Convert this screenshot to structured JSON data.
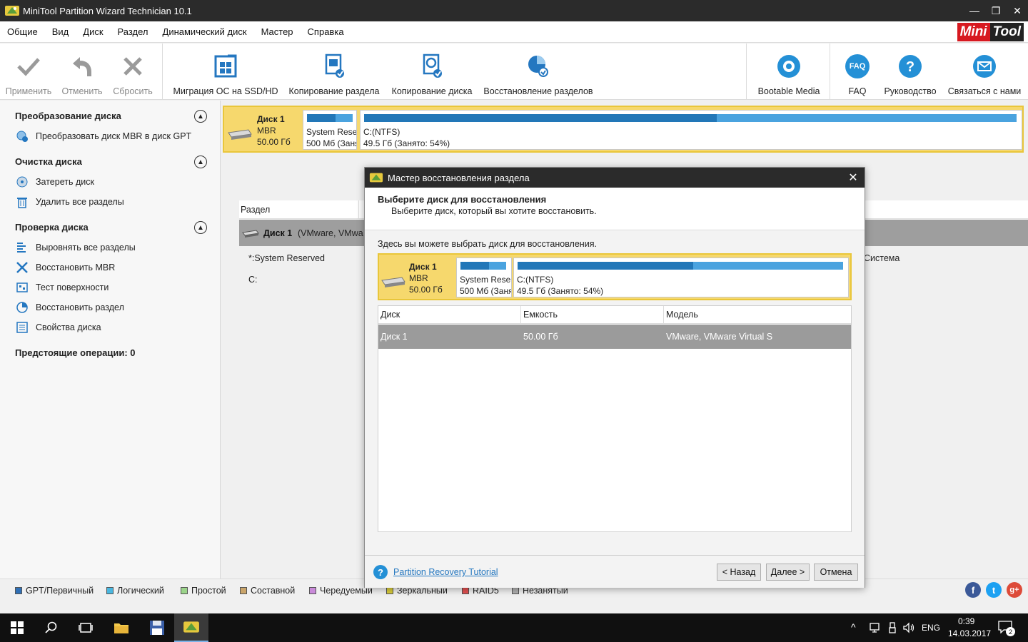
{
  "window": {
    "title": "MiniTool Partition Wizard Technician 10.1",
    "controls": {
      "minimize": "—",
      "maximize": "❐",
      "close": "✕"
    }
  },
  "menu": [
    "Общие",
    "Вид",
    "Диск",
    "Раздел",
    "Динамический диск",
    "Мастер",
    "Справка"
  ],
  "brand": {
    "part1": "Mini",
    "part2": "Tool",
    "colors": {
      "red": "#d71920",
      "dark": "#222222"
    }
  },
  "toolbar": {
    "apply": "Применить",
    "undo": "Отменить",
    "discard": "Сбросить",
    "migrate": "Миграция ОС на SSD/HD",
    "copy_partition": "Копирование раздела",
    "copy_disk": "Копирование диска",
    "recover_partitions": "Восстановление разделов",
    "bootable": "Bootable Media",
    "faq": "FAQ",
    "faq_icon_text": "FAQ",
    "manual": "Руководство",
    "contact": "Связаться с нами"
  },
  "sidebar": {
    "sections": [
      {
        "title": "Преобразование диска",
        "items": [
          "Преобразовать диск MBR в диск GPT"
        ]
      },
      {
        "title": "Очистка диска",
        "items": [
          "Затереть диск",
          "Удалить все разделы"
        ]
      },
      {
        "title": "Проверка диска",
        "items": [
          "Выровнять все разделы",
          "Восстановить MBR",
          "Тест поверхности",
          "Восстановить раздел",
          "Свойства диска"
        ]
      }
    ],
    "pending": "Предстоящие операции: 0"
  },
  "disk_map": {
    "name": "Диск 1",
    "type": "MBR",
    "size": "50.00 Гб",
    "partitions": [
      {
        "label": "System Rese",
        "detail": "500 Мб (Заня",
        "used_fraction": 0.62
      },
      {
        "label": "C:(NTFS)",
        "detail": "49.5 Гб (Занято: 54%)",
        "used_fraction": 0.54
      }
    ]
  },
  "grid": {
    "col_partition": "Раздел",
    "disk_row": "Диск 1",
    "disk_row_detail": "(VMware, VMwa",
    "rows": [
      "*:System Reserved",
      "C:"
    ],
    "right_col_value": "Система"
  },
  "legend": [
    {
      "label": "GPT/Первичный",
      "color": "#2f6fb5"
    },
    {
      "label": "Логический",
      "color": "#49b7e0"
    },
    {
      "label": "Простой",
      "color": "#9bd48a"
    },
    {
      "label": "Составной",
      "color": "#c9a46a"
    },
    {
      "label": "Чередуемый",
      "color": "#c98ad9"
    },
    {
      "label": "Зеркальный",
      "color": "#d9cc3a"
    },
    {
      "label": "RAID5",
      "color": "#e35151"
    },
    {
      "label": "Незанятый",
      "color": "#b0b0b0"
    }
  ],
  "social": {
    "facebook": "f",
    "twitter": "t",
    "gplus": "g+"
  },
  "dialog": {
    "title": "Мастер восстановления раздела",
    "close": "✕",
    "heading": "Выберите диск для восстановления",
    "subheading": "Выберите диск, который вы хотите восстановить.",
    "hint": "Здесь вы можете выбрать диск для восстановления.",
    "disk": {
      "name": "Диск 1",
      "type": "MBR",
      "size": "50.00 Гб",
      "partitions": [
        {
          "label": "System Rese",
          "detail": "500 Мб (Заня",
          "used_fraction": 0.62
        },
        {
          "label": "C:(NTFS)",
          "detail": "49.5 Гб (Занято: 54%)",
          "used_fraction": 0.54
        }
      ]
    },
    "table": {
      "headers": [
        "Диск",
        "Емкость",
        "Модель"
      ],
      "rows": [
        [
          "Диск 1",
          "50.00 Гб",
          "VMware, VMware Virtual S"
        ]
      ]
    },
    "tutorial_link": "Partition Recovery Tutorial",
    "help_icon": "?",
    "buttons": {
      "back": "< Назад",
      "next": "Далее >",
      "cancel": "Отмена"
    }
  },
  "taskbar": {
    "lang": "ENG",
    "time": "0:39",
    "date": "14.03.2017",
    "notifications": "2"
  }
}
